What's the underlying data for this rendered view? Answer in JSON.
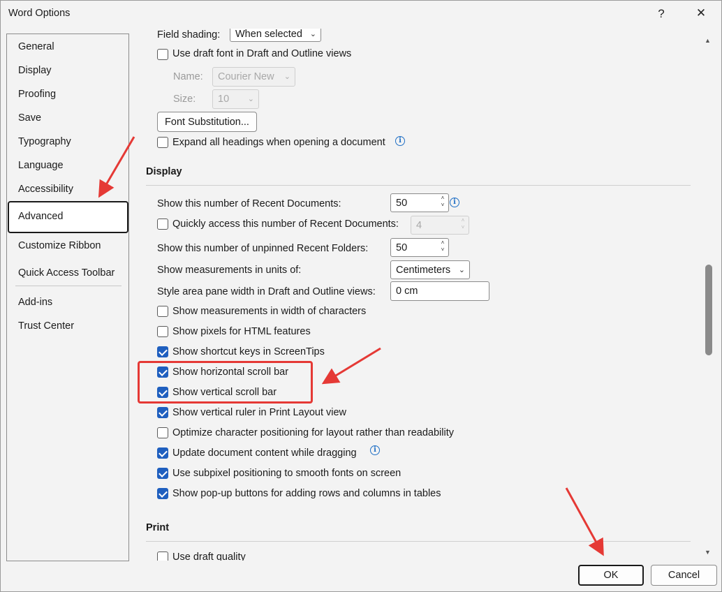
{
  "window": {
    "title": "Word Options",
    "help": "?",
    "close": "✕"
  },
  "nav": {
    "items": [
      "General",
      "Display",
      "Proofing",
      "Save",
      "Typography",
      "Language",
      "Accessibility",
      "Advanced",
      "Customize Ribbon",
      "Quick Access Toolbar",
      "Add-ins",
      "Trust Center"
    ],
    "active": "Advanced"
  },
  "top": {
    "field_shading_label": "Field shading:",
    "field_shading_value": "When selected",
    "draft_font_label": "Use draft font in Draft and Outline views",
    "name_label": "Name:",
    "name_value": "Courier New",
    "size_label": "Size:",
    "size_value": "10",
    "font_sub_button": "Font Substitution...",
    "expand_headings_label": "Expand all headings when opening a document"
  },
  "display": {
    "heading": "Display",
    "recent_docs_label": "Show this number of Recent Documents:",
    "recent_docs_value": "50",
    "quick_access_label": "Quickly access this number of Recent Documents:",
    "quick_access_value": "4",
    "recent_folders_label": "Show this number of unpinned Recent Folders:",
    "recent_folders_value": "50",
    "units_label": "Show measurements in units of:",
    "units_value": "Centimeters",
    "style_area_label": "Style area pane width in Draft and Outline views:",
    "style_area_value": "0 cm",
    "checkboxes": [
      {
        "label": "Show measurements in width of characters",
        "checked": false
      },
      {
        "label": "Show pixels for HTML features",
        "checked": false
      },
      {
        "label": "Show shortcut keys in ScreenTips",
        "checked": true
      },
      {
        "label": "Show horizontal scroll bar",
        "checked": true
      },
      {
        "label": "Show vertical scroll bar",
        "checked": true
      },
      {
        "label": "Show vertical ruler in Print Layout view",
        "checked": true
      },
      {
        "label": "Optimize character positioning for layout rather than readability",
        "checked": false
      },
      {
        "label": "Update document content while dragging",
        "checked": true
      },
      {
        "label": "Use subpixel positioning to smooth fonts on screen",
        "checked": true
      },
      {
        "label": "Show pop-up buttons for adding rows and columns in tables",
        "checked": true
      }
    ]
  },
  "print": {
    "heading": "Print",
    "draft_quality_label": "Use draft quality"
  },
  "footer": {
    "ok": "OK",
    "cancel": "Cancel"
  },
  "colors": {
    "accent": "#1f5fbf",
    "annotation": "#e53935"
  }
}
